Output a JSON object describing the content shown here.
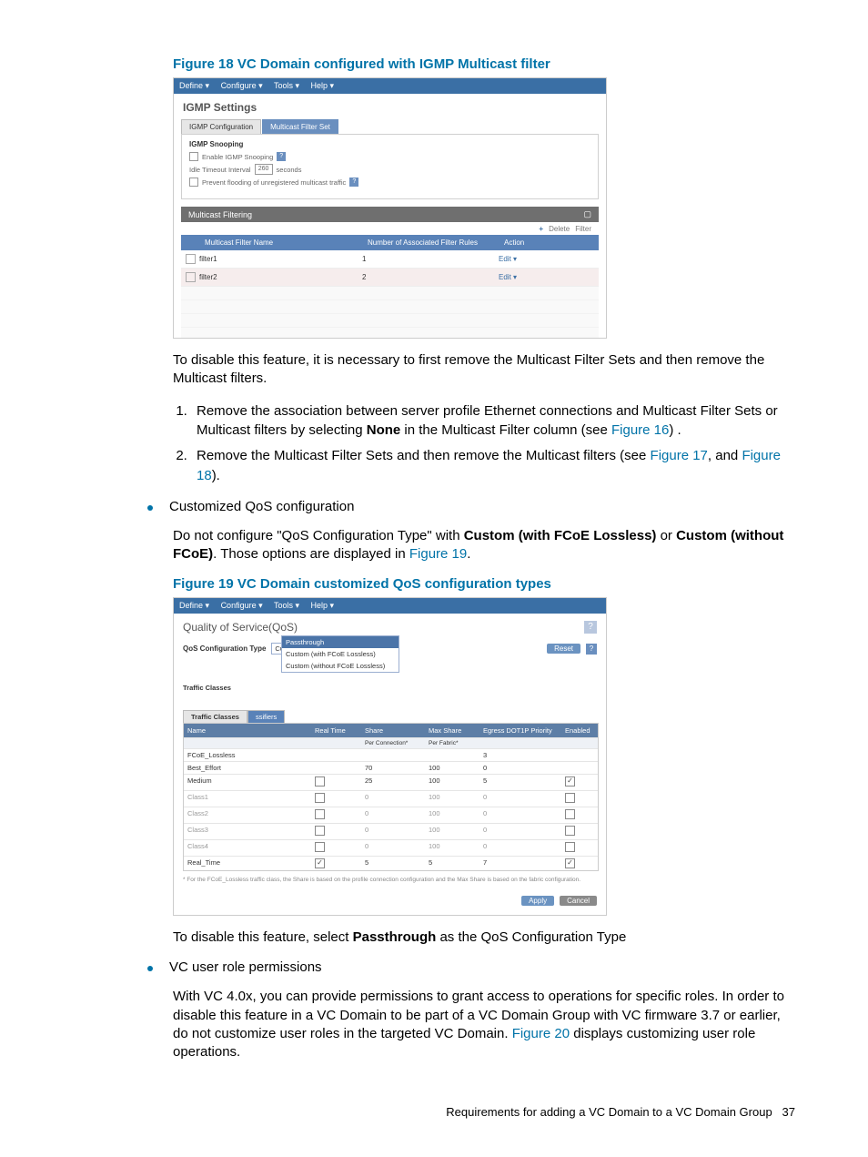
{
  "figure18": {
    "caption": "Figure 18 VC Domain configured with IGMP Multicast filter",
    "menubar": [
      "Define ▾",
      "Configure ▾",
      "Tools ▾",
      "Help ▾"
    ],
    "panel_title": "IGMP Settings",
    "tabs": {
      "igmp": "IGMP Configuration",
      "mcast": "Multicast Filter Set"
    },
    "snooping": {
      "group": "IGMP Snooping",
      "enable": "Enable IGMP Snooping",
      "idle_label_pre": "Idle Timeout Interval",
      "idle_value": "260",
      "idle_label_post": "seconds",
      "prevent": "Prevent flooding of unregistered multicast traffic"
    },
    "mcast_section": "Multicast Filtering",
    "toolbar": {
      "add": "+",
      "delete": "Delete",
      "filter": "Filter"
    },
    "columns": {
      "name": "Multicast Filter Name",
      "rules": "Number of Associated Filter Rules",
      "action": "Action"
    },
    "rows": [
      {
        "name": "filter1",
        "rules": "1",
        "action": "Edit ▾"
      },
      {
        "name": "filter2",
        "rules": "2",
        "action": "Edit ▾"
      }
    ]
  },
  "para1": "To disable this feature, it is necessary to first remove the Multicast Filter Sets and then remove the Multicast filters.",
  "step1_a": "Remove the association between server profile Ethernet connections and Multicast Filter Sets or Multicast filters by selecting ",
  "step1_b": "None",
  "step1_c": " in the Multicast Filter column (see ",
  "step1_link": "Figure 16",
  "step1_d": ") .",
  "step2_a": "Remove the Multicast Filter Sets and then remove the Multicast filters (see ",
  "step2_link1": "Figure 17",
  "step2_b": ", and ",
  "step2_link2": "Figure 18",
  "step2_c": ").",
  "bullet_qos": "Customized QoS configuration",
  "qos_para_a": "Do not configure \"QoS Configuration Type\" with ",
  "qos_para_b": "Custom (with FCoE Lossless)",
  "qos_para_c": " or ",
  "qos_para_d": "Custom (without FCoE)",
  "qos_para_e": ". Those options are displayed in ",
  "qos_para_link": "Figure 19",
  "qos_para_f": ".",
  "figure19": {
    "caption": "Figure 19 VC Domain customized QoS configuration types",
    "menubar": [
      "Define ▾",
      "Configure ▾",
      "Tools ▾",
      "Help ▾"
    ],
    "panel_title": "Quality of Service(QoS)",
    "config_label": "QoS Configuration Type",
    "select_value": "Custom (with FCoE Lossless)",
    "options": [
      "Passthrough",
      "Custom (with FCoE Lossless)",
      "Custom (without FCoE Lossless)"
    ],
    "reset_btn": "Reset",
    "tabs": {
      "tc": "Traffic Classes",
      "tcx": "ssifiers"
    },
    "side_label": "Traffic Classes",
    "columns": [
      "Name",
      "Real Time",
      "Share",
      "Max Share",
      "Egress DOT1P Priority",
      "Enabled"
    ],
    "sub": [
      "",
      "",
      "Per Connection*",
      "Per Fabric*",
      "",
      ""
    ],
    "rows": [
      {
        "name": "FCoE_Lossless",
        "rt": "",
        "share": "",
        "max": "",
        "pri": "3",
        "en": ""
      },
      {
        "name": "Best_Effort",
        "rt": "",
        "share": "70",
        "max": "100",
        "pri": "0",
        "en": ""
      },
      {
        "name": "Medium",
        "rt": "cb",
        "share": "25",
        "max": "100",
        "pri": "5",
        "en": "ck"
      },
      {
        "name": "Class1",
        "rt": "cb",
        "share": "0",
        "max": "100",
        "pri": "0",
        "en": "cb"
      },
      {
        "name": "Class2",
        "rt": "cb",
        "share": "0",
        "max": "100",
        "pri": "0",
        "en": "cb"
      },
      {
        "name": "Class3",
        "rt": "cb",
        "share": "0",
        "max": "100",
        "pri": "0",
        "en": "cb"
      },
      {
        "name": "Class4",
        "rt": "cb",
        "share": "0",
        "max": "100",
        "pri": "0",
        "en": "cb"
      },
      {
        "name": "Real_Time",
        "rt": "ck",
        "share": "5",
        "max": "5",
        "pri": "7",
        "en": "ck"
      }
    ],
    "footnote": "* For the FCoE_Lossless traffic class, the Share is based on the profile connection configuration and the Max Share is based on the fabric configuration.",
    "apply": "Apply",
    "cancel": "Cancel"
  },
  "qos_disable_a": "To disable this feature, select ",
  "qos_disable_b": "Passthrough",
  "qos_disable_c": " as the QoS Configuration Type",
  "bullet_roles": "VC user role permissions",
  "roles_para_a": "With VC 4.0x, you can provide permissions to grant access to operations for specific roles. In order to disable this feature in a VC Domain to be part of a VC Domain Group with VC firmware 3.7 or earlier, do not customize user roles in the targeted VC Domain. ",
  "roles_link": "Figure 20",
  "roles_para_b": " displays customizing user role operations.",
  "footer_text": "Requirements for adding a VC Domain to a VC Domain Group",
  "footer_page": "37"
}
